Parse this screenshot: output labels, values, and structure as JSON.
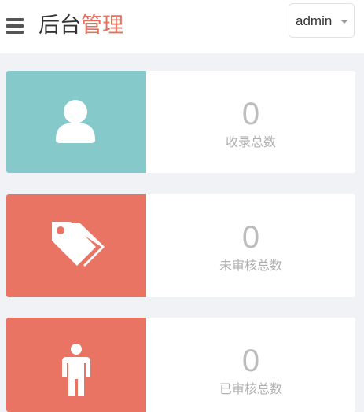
{
  "header": {
    "title_main": "后台",
    "title_accent": "管理",
    "user": "admin",
    "menu_icon": "menu-icon",
    "caret_icon": "caret-down-icon"
  },
  "colors": {
    "accent": "#ea6f5a",
    "teal": "#86c9ca",
    "coral": "#ea7463",
    "muted_text": "#b0b0b0"
  },
  "stats": [
    {
      "value": "0",
      "label": "收录总数",
      "icon": "user-icon"
    },
    {
      "value": "0",
      "label": "未审核总数",
      "icon": "tags-icon"
    },
    {
      "value": "0",
      "label": "已审核总数",
      "icon": "person-icon"
    }
  ]
}
